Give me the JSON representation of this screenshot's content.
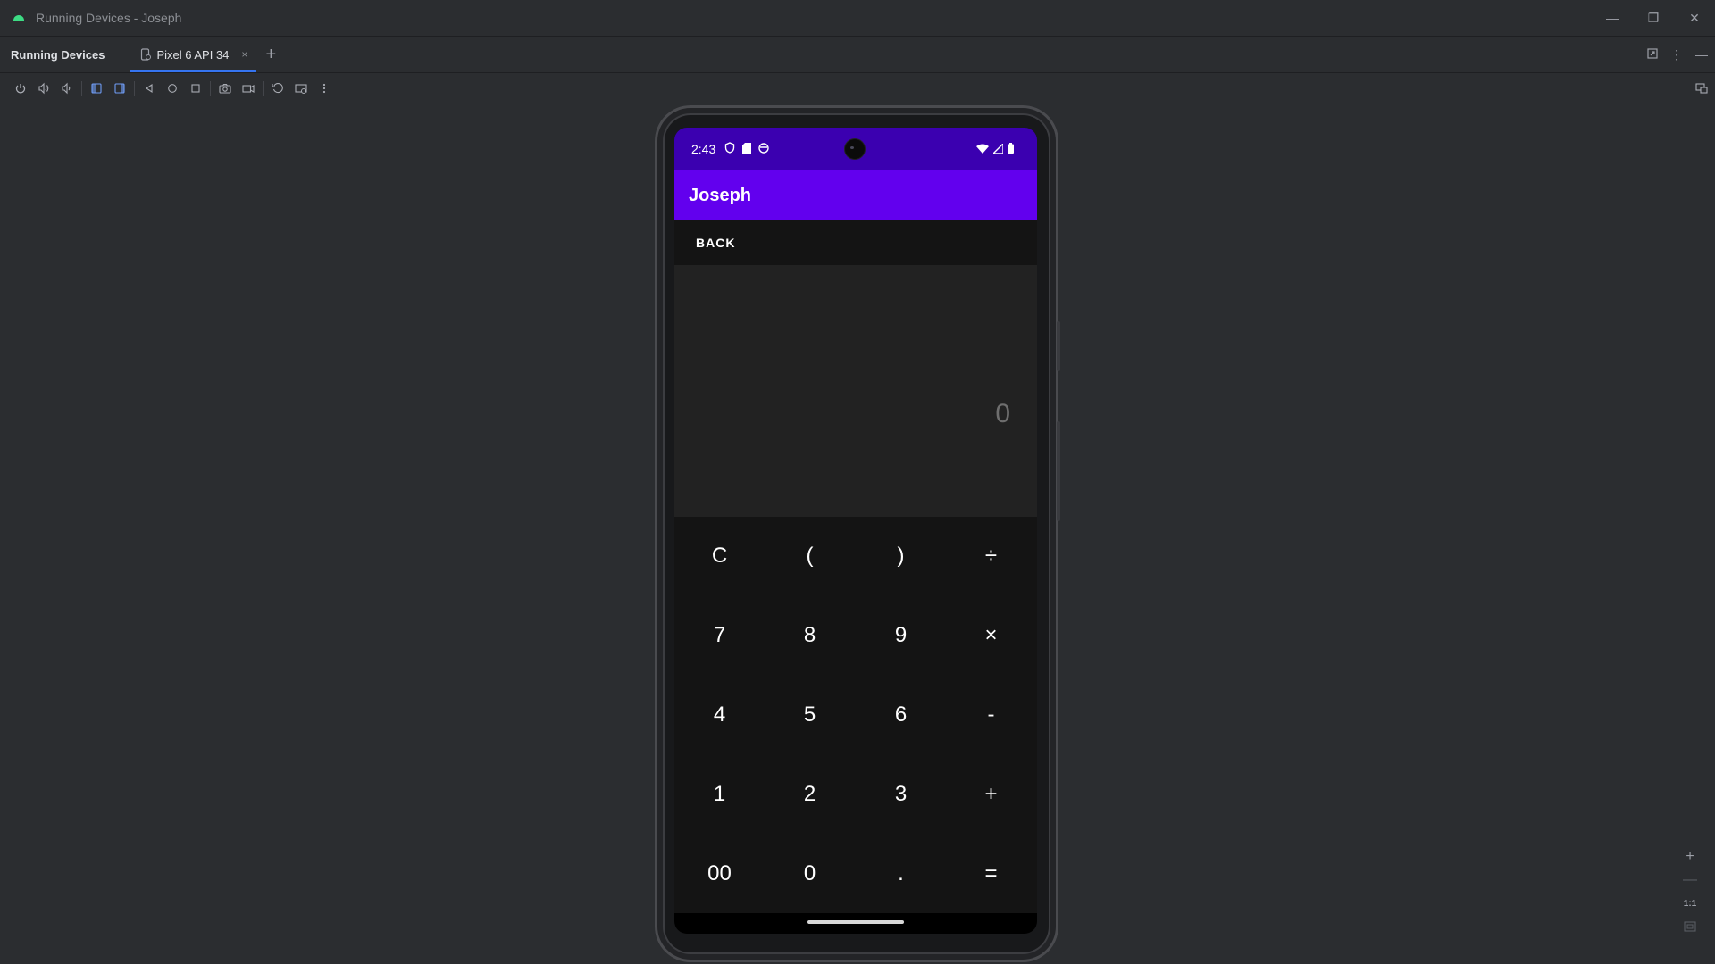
{
  "window": {
    "title": "Running Devices - Joseph",
    "controls": {
      "minimize": "—",
      "restore": "❐",
      "close": "✕"
    }
  },
  "tabbar": {
    "tool_title": "Running Devices",
    "tab_label": "Pixel 6 API 34",
    "tab_close": "×",
    "add_tab": "+"
  },
  "toolbar": {
    "icons": [
      "power-icon",
      "volume-up-icon",
      "volume-down-icon",
      "rotate-left-icon",
      "rotate-right-icon",
      "back-icon",
      "home-icon",
      "overview-icon",
      "screenshot-icon",
      "screen-record-icon",
      "snapshot-icon",
      "extended-controls-icon",
      "more-icon",
      "device-mirroring-icon"
    ]
  },
  "device": {
    "status_time": "2:43",
    "app_title": "Joseph",
    "back_label": "BACK",
    "display_value": "0",
    "keys": [
      [
        "C",
        "(",
        ")",
        "÷"
      ],
      [
        "7",
        "8",
        "9",
        "×"
      ],
      [
        "4",
        "5",
        "6",
        "-"
      ],
      [
        "1",
        "2",
        "3",
        "+"
      ],
      [
        "00",
        "0",
        ".",
        "="
      ]
    ]
  },
  "zoom": {
    "zoom_in": "+",
    "zoom_out": "—",
    "actual_size": "1:1"
  },
  "colors": {
    "ide_background": "#2b2d30",
    "status_bar": "#3b00b0",
    "app_bar": "#6200ee",
    "tab_underline": "#3574f0"
  }
}
